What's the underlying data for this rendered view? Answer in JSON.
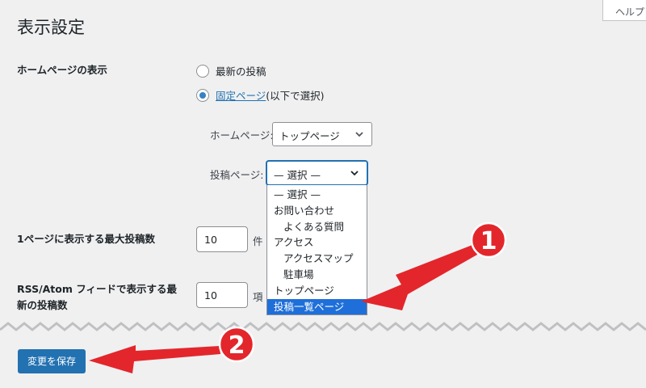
{
  "help_tab": "ヘルプ",
  "page_title": "表示設定",
  "homepage_display": {
    "label": "ホームページの表示",
    "option_latest": "最新の投稿",
    "option_static_link": "固定ページ",
    "option_static_note": " (以下で選択)",
    "homepage_label": "ホームページ:",
    "homepage_value": "トップページ",
    "posts_page_label": "投稿ページ:",
    "posts_page_value": "— 選択 —",
    "dropdown_options": [
      "— 選択 —",
      "お問い合わせ",
      "よくある質問",
      "アクセス",
      "アクセスマップ",
      "駐車場",
      "トップページ",
      "投稿一覧ページ"
    ]
  },
  "posts_per_page": {
    "label": "1ページに表示する最大投稿数",
    "value": "10",
    "unit": "件"
  },
  "feed_items": {
    "label_line1": "RSS/Atom フィードで表示する最",
    "label_line2": "新の投稿数",
    "value": "10",
    "unit": "項"
  },
  "save_button": "変更を保存",
  "annotations": {
    "badge1": "1",
    "badge2": "2",
    "color": "#e3262b"
  }
}
